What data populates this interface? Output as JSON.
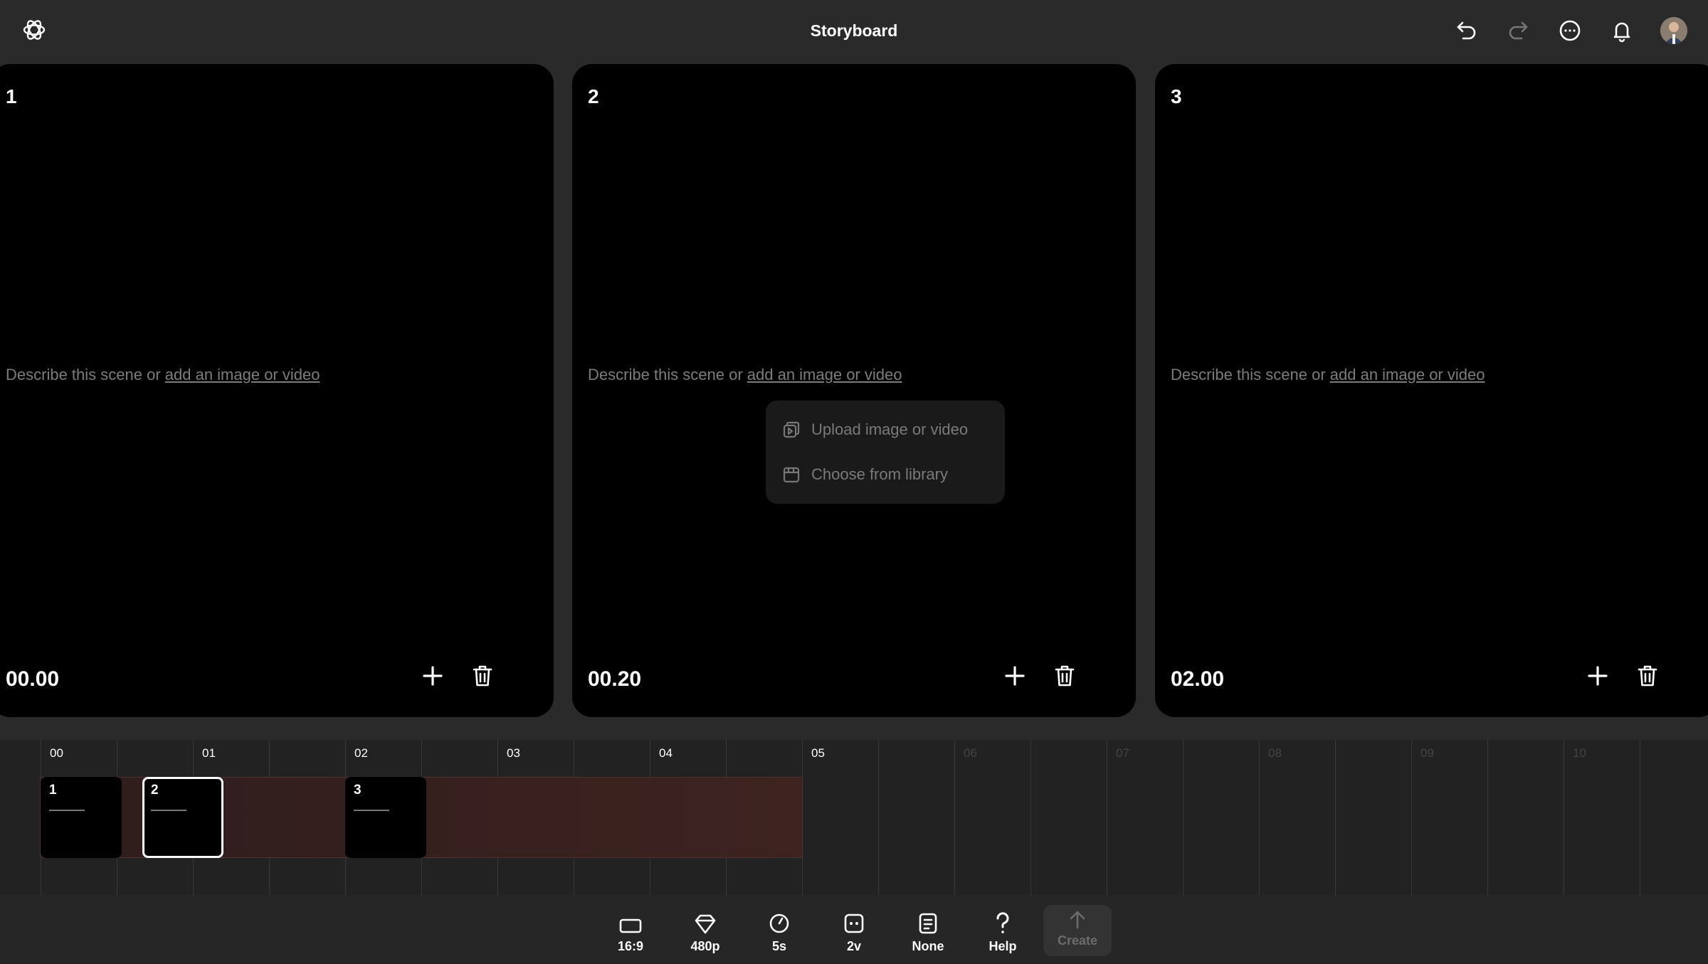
{
  "header": {
    "title": "Storyboard",
    "icons": [
      "openai-logo-icon",
      "undo-icon",
      "redo-icon",
      "more-icon",
      "bell-icon",
      "user-avatar"
    ]
  },
  "scenes": [
    {
      "number": "1",
      "prompt": "Describe this scene or ",
      "link": "add an image or video",
      "time": "00.00"
    },
    {
      "number": "2",
      "prompt": "Describe this scene or ",
      "link": "add an image or video",
      "time": "00.20"
    },
    {
      "number": "3",
      "prompt": "Describe this scene or ",
      "link": "add an image or video",
      "time": "02.00"
    }
  ],
  "dropdown": {
    "upload": "Upload image or video",
    "library": "Choose from library"
  },
  "timeline": {
    "ticks": [
      "00",
      "01",
      "02",
      "03",
      "04",
      "05",
      "06",
      "07",
      "08",
      "09",
      "10"
    ],
    "clips": [
      "1",
      "2",
      "3"
    ],
    "selected_clip": "2"
  },
  "toolbar": {
    "aspect": "16:9",
    "resolution": "480p",
    "duration": "5s",
    "variations": "2v",
    "preset": "None",
    "help": "Help",
    "create": "Create"
  },
  "colors": {
    "background": "#2a2a2a",
    "card": "#000000",
    "track": "#3a2220",
    "muted_text": "#7c7c7c"
  }
}
